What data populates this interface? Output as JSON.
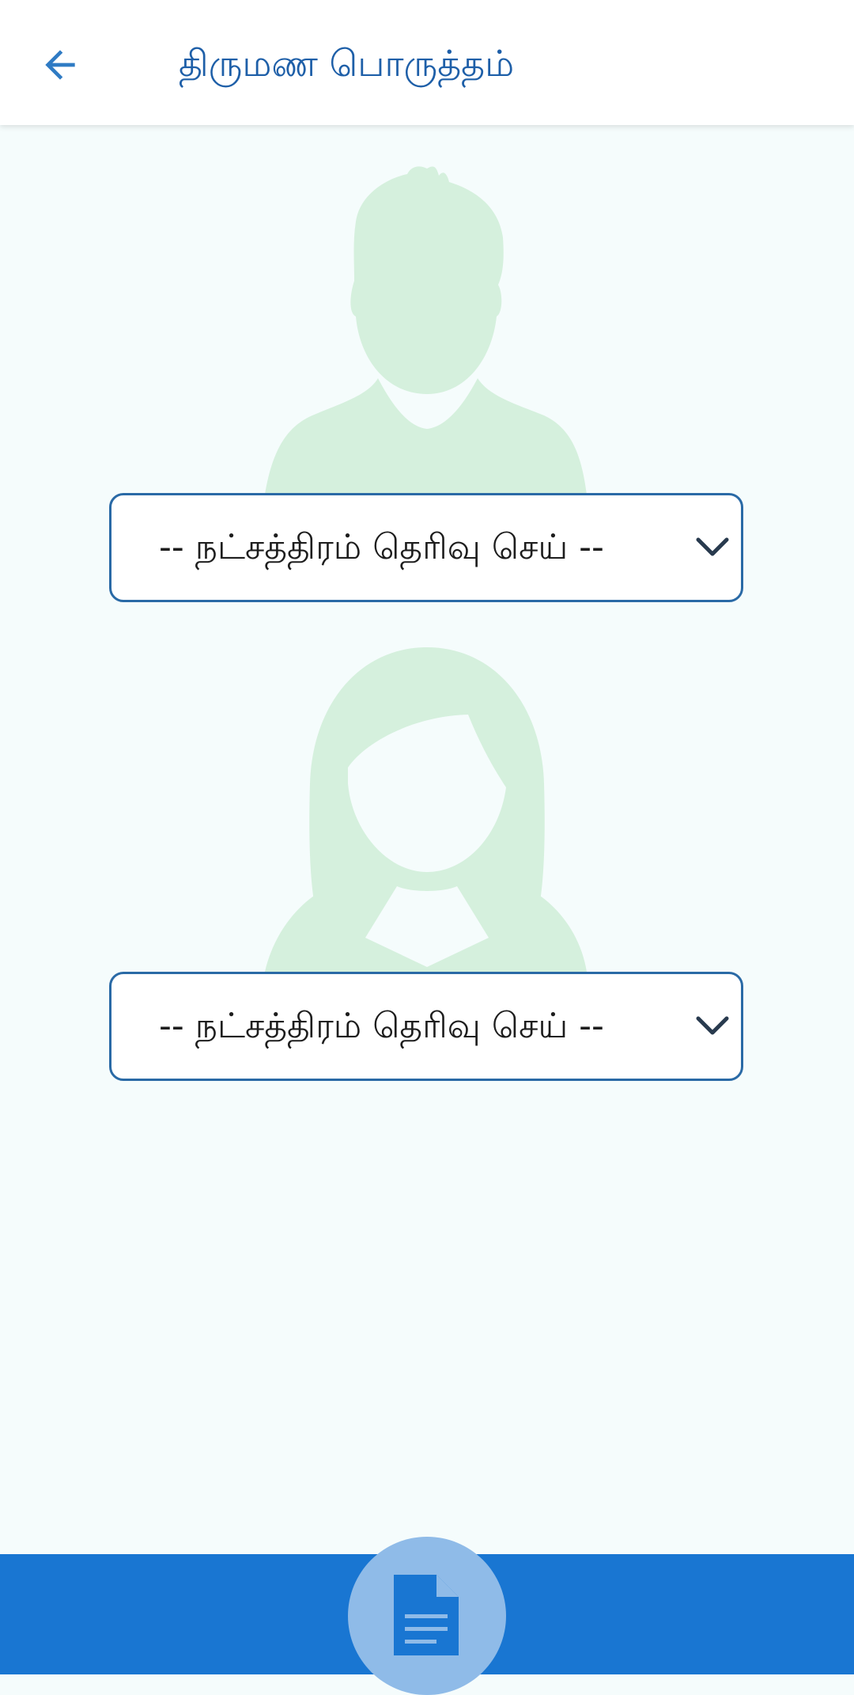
{
  "header": {
    "title": "திருமண பொருத்தம்",
    "back_icon": "arrow-left-icon"
  },
  "groom": {
    "select_value": "-- நட்சத்திரம் தெரிவு செய் --",
    "icon": "male-silhouette-icon"
  },
  "bride": {
    "select_value": "-- நட்சத்திரம் தெரிவு செய் --",
    "icon": "female-silhouette-icon"
  },
  "bottom": {
    "action_icon": "document-icon"
  },
  "colors": {
    "primary": "#1976d2",
    "title": "#1e5fa8",
    "silhouette": "#d5f0dd",
    "background": "#f5fcfc",
    "select_border": "#2a6aa6"
  }
}
